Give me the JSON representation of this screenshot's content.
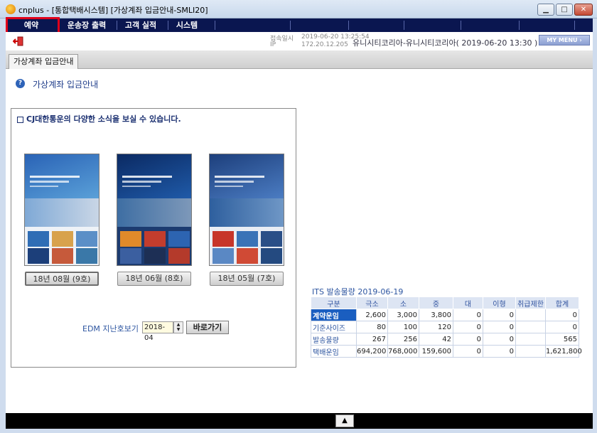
{
  "window": {
    "title": "cnplus - [통합택배시스템] [가상계좌 입금안내-SMLI20]",
    "min_label": "▁",
    "max_label": "□",
    "close_label": "✕"
  },
  "menu": {
    "items": [
      {
        "label": "예약"
      },
      {
        "label": "운송장 출력"
      },
      {
        "label": "고객 실적"
      },
      {
        "label": "시스템"
      }
    ],
    "highlight_color": "#e0001a",
    "bar_color": "#0a1650"
  },
  "info": {
    "connect_label": "접속일시",
    "connect_value": "2019-06-20 13:25:54",
    "ip_label": "IP",
    "ip_value": "172.20.12.205",
    "company_text": "유니시티코리아-유니시티코리아( 2019-06-20 13:30 )",
    "my_menu_label": "MY MENU ›"
  },
  "tabs": [
    {
      "label": "가상계좌 입금안내"
    }
  ],
  "page": {
    "title": "가상계좌 입금안내"
  },
  "news": {
    "brand": "CJ",
    "header_text": "대한통운의 다양한 소식을 보실 수 있습니다.",
    "issues": [
      {
        "label": "18년 08월 (9호)"
      },
      {
        "label": "18년 06월 (8호)"
      },
      {
        "label": "18년 05월 (7호)"
      }
    ]
  },
  "edm": {
    "label": "EDM 지난호보기",
    "selected": "2018-04",
    "go_label": "바로가기"
  },
  "its": {
    "title": "ITS 발송물량 2019-06-19",
    "headers": [
      "구분",
      "극소",
      "소",
      "중",
      "대",
      "이형",
      "취급제한",
      "합계"
    ],
    "rows": [
      [
        "계약운임",
        "2,600",
        "3,000",
        "3,800",
        "0",
        "0",
        "",
        "0"
      ],
      [
        "기준사이즈",
        "80",
        "100",
        "120",
        "0",
        "0",
        "",
        "0"
      ],
      [
        "발송물량",
        "267",
        "256",
        "42",
        "0",
        "0",
        "",
        "565"
      ],
      [
        "택배운임",
        "694,200",
        "768,000",
        "159,600",
        "0",
        "0",
        "",
        "1,621,800"
      ]
    ]
  },
  "status": {
    "arrow_label": "▲"
  }
}
